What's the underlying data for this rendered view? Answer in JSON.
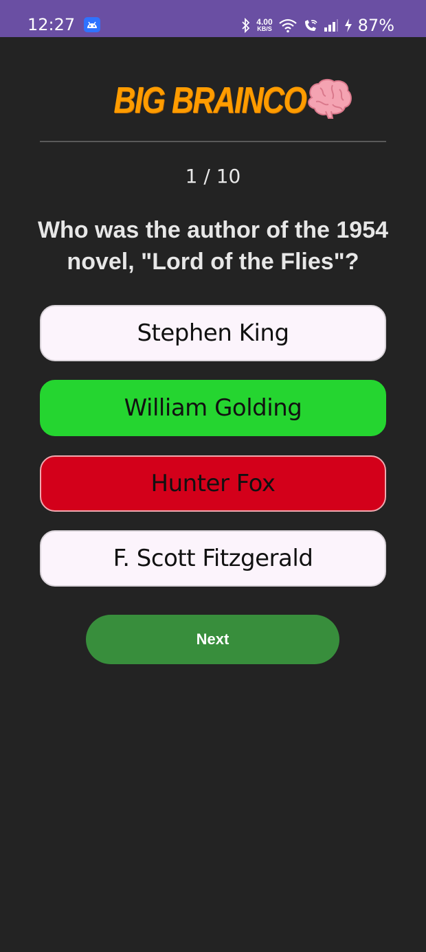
{
  "status_bar": {
    "time": "12:27",
    "net_speed_value": "4.00",
    "net_speed_unit": "KB/S",
    "battery": "87%",
    "icons": [
      "android-app-icon",
      "bluetooth-icon",
      "wifi-icon",
      "wifi-call-icon",
      "signal-icon",
      "charging-icon"
    ]
  },
  "header": {
    "logo_text": "Big BrainCo",
    "logo_icon": "brain-icon",
    "logo_color": "#ff9c00"
  },
  "quiz": {
    "counter": "1 / 10",
    "question": "Who was the author of the 1954 novel, \"Lord of the Flies\"?",
    "answers": [
      {
        "label": "Stephen King",
        "state": "neutral"
      },
      {
        "label": "William Golding",
        "state": "correct"
      },
      {
        "label": "Hunter Fox",
        "state": "wrong"
      },
      {
        "label": "F. Scott Fitzgerald",
        "state": "neutral"
      }
    ],
    "next_label": "Next"
  },
  "colors": {
    "background": "#232323",
    "status_bar": "#6a4fa3",
    "correct": "#25d530",
    "wrong": "#d3001a",
    "next_button": "#388e3c"
  }
}
